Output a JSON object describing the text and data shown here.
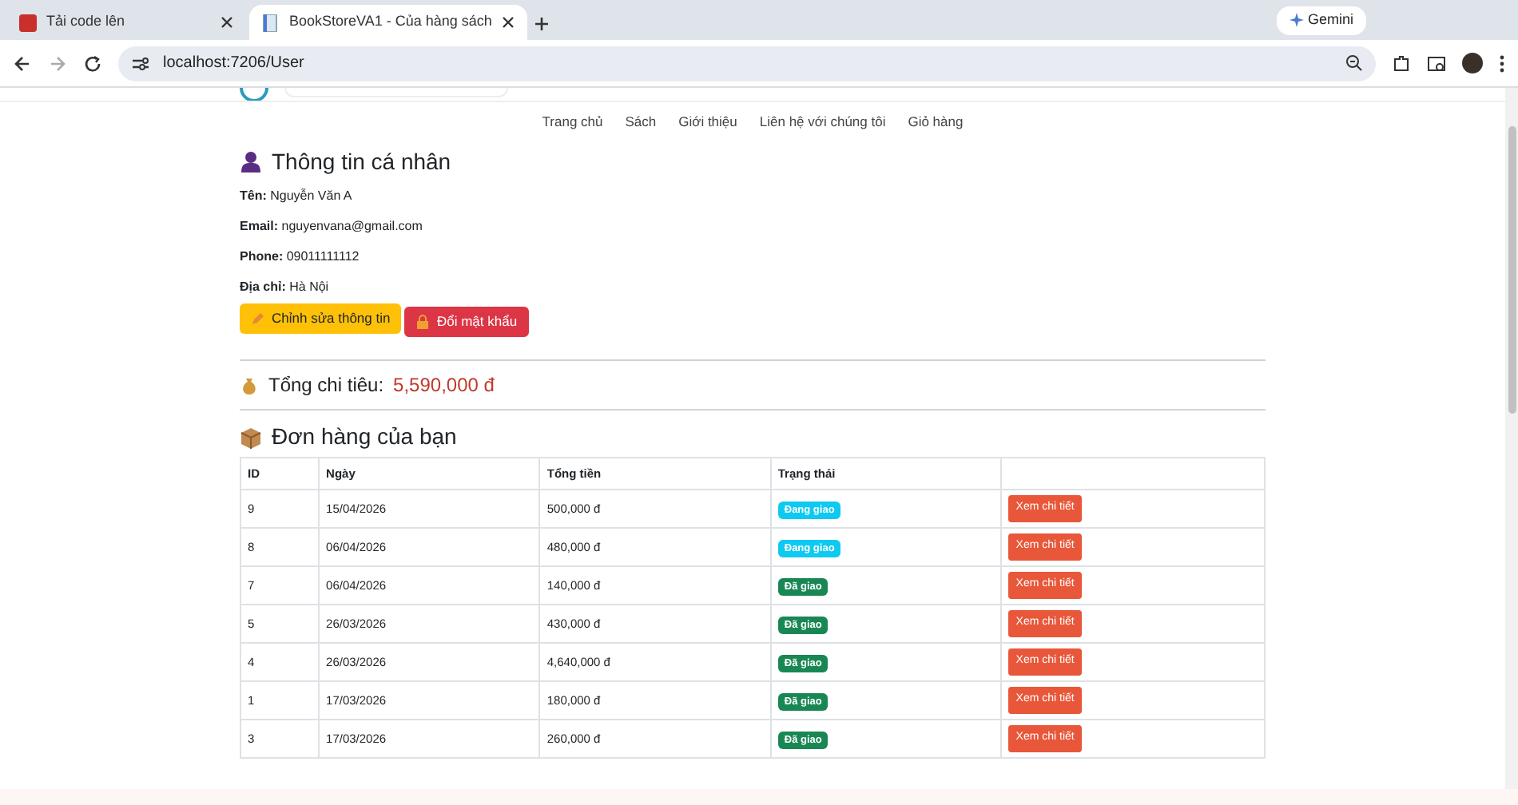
{
  "browser": {
    "tabs": [
      {
        "title": "Tải code lên",
        "selected": false
      },
      {
        "title": "BookStoreVA1 - Của hàng sách",
        "selected": true
      }
    ],
    "address": "localhost:7206/User",
    "gemini": "Gemini"
  },
  "nav": [
    "Trang chủ",
    "Sách",
    "Giới thiệu",
    "Liên hệ với chúng tôi",
    "Giỏ hàng"
  ],
  "profile": {
    "title": "Thông tin cá nhân",
    "fields": [
      {
        "label": "Tên:",
        "value": "Nguyễn Văn A"
      },
      {
        "label": "Email:",
        "value": "nguyenvana@gmail.com"
      },
      {
        "label": "Phone:",
        "value": "09011111112"
      },
      {
        "label": "Địa chỉ:",
        "value": "Hà Nội"
      }
    ],
    "buttons": [
      {
        "label": "Chỉnh sửa thông tin",
        "kind": "edit"
      },
      {
        "label": "Đổi mật khẩu",
        "kind": "password"
      }
    ]
  },
  "total": {
    "label": "Tổng chi tiêu:",
    "value": "5,590,000 đ"
  },
  "orders": {
    "title": "Đơn hàng của bạn",
    "columns": [
      "ID",
      "Ngày",
      "Tổng tiền",
      "Trạng thái"
    ],
    "rows": [
      {
        "id": "9",
        "date": "15/04/2026",
        "total": "500,000 đ",
        "status": {
          "label": "Đang giao",
          "kind": "shipping"
        },
        "action": "Xem chi tiết"
      },
      {
        "id": "8",
        "date": "06/04/2026",
        "total": "480,000 đ",
        "status": {
          "label": "Đang giao",
          "kind": "shipping"
        },
        "action": "Xem chi tiết"
      },
      {
        "id": "7",
        "date": "06/04/2026",
        "total": "140,000 đ",
        "status": {
          "label": "Đã giao",
          "kind": "delivered"
        },
        "action": "Xem chi tiết"
      },
      {
        "id": "5",
        "date": "26/03/2026",
        "total": "430,000 đ",
        "status": {
          "label": "Đã giao",
          "kind": "delivered"
        },
        "action": "Xem chi tiết"
      },
      {
        "id": "4",
        "date": "26/03/2026",
        "total": "4,640,000 đ",
        "status": {
          "label": "Đã giao",
          "kind": "delivered"
        },
        "action": "Xem chi tiết"
      },
      {
        "id": "1",
        "date": "17/03/2026",
        "total": "180,000 đ",
        "status": {
          "label": "Đã giao",
          "kind": "delivered"
        },
        "action": "Xem chi tiết"
      },
      {
        "id": "3",
        "date": "17/03/2026",
        "total": "260,000 đ",
        "status": {
          "label": "Đã giao",
          "kind": "delivered"
        },
        "action": "Xem chi tiết"
      }
    ]
  }
}
